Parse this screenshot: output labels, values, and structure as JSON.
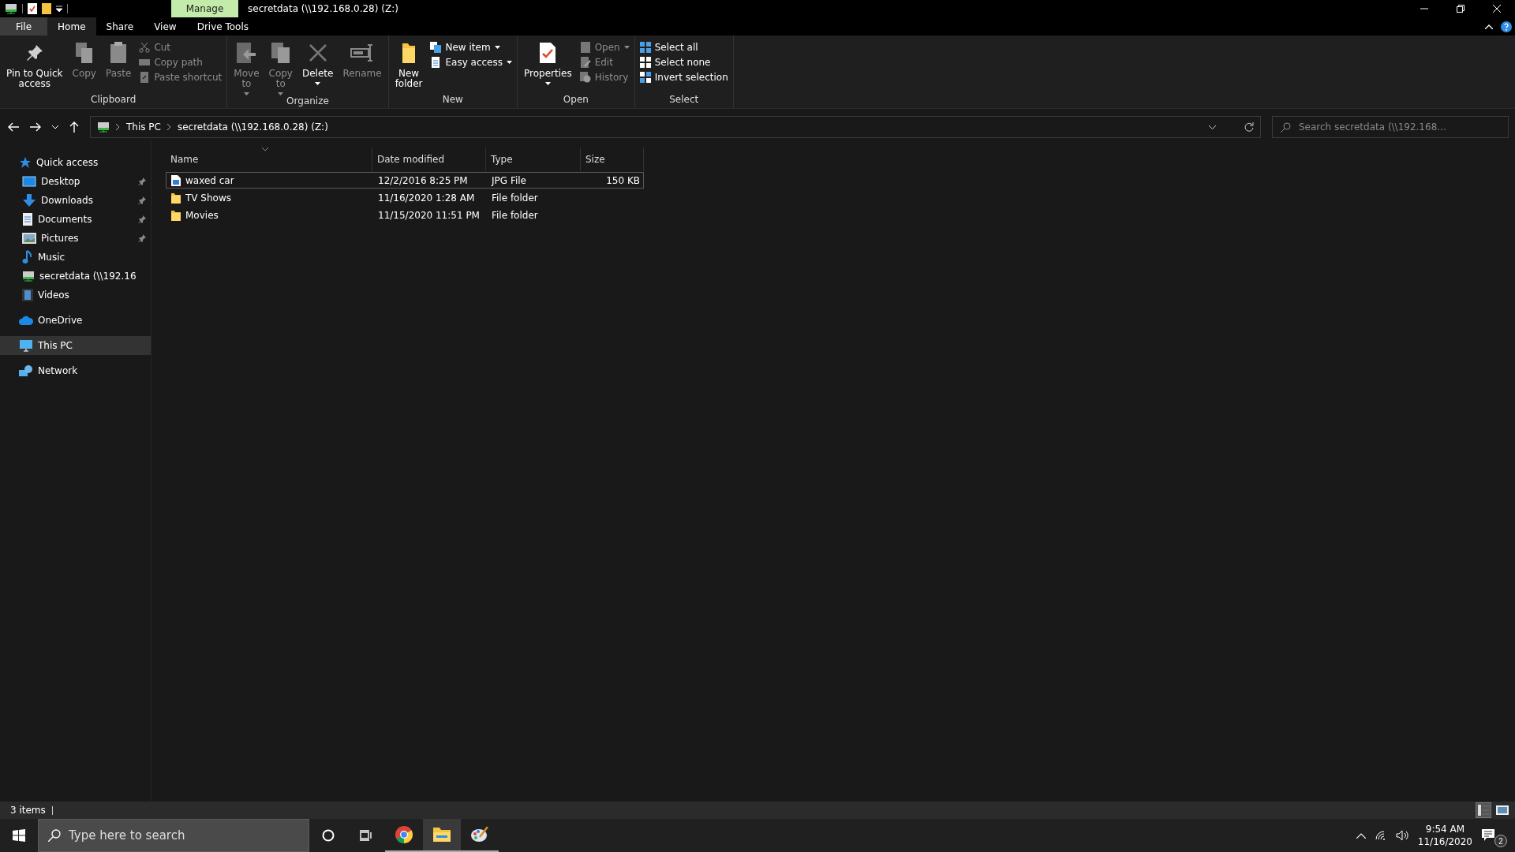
{
  "window": {
    "title": "secretdata (\\\\192.168.0.28) (Z:)",
    "context_tab": "Manage"
  },
  "ribbon_tabs": [
    {
      "label": "File",
      "selected": false,
      "kind": "file"
    },
    {
      "label": "Home",
      "selected": true,
      "kind": "tab"
    },
    {
      "label": "Share",
      "selected": false,
      "kind": "tab"
    },
    {
      "label": "View",
      "selected": false,
      "kind": "tab"
    },
    {
      "label": "Drive Tools",
      "selected": false,
      "kind": "tab"
    }
  ],
  "ribbon_groups": [
    {
      "label": "Clipboard",
      "items": [
        {
          "kind": "large",
          "label": "Pin to Quick\naccess",
          "disabled": false,
          "caret": false
        },
        {
          "kind": "large",
          "label": "Copy",
          "disabled": true,
          "caret": false
        },
        {
          "kind": "large",
          "label": "Paste",
          "disabled": true,
          "caret": false
        },
        {
          "kind": "stack",
          "items": [
            {
              "label": "Cut",
              "disabled": true,
              "caret": false
            },
            {
              "label": "Copy path",
              "disabled": true,
              "caret": false
            },
            {
              "label": "Paste shortcut",
              "disabled": true,
              "caret": false
            }
          ]
        }
      ]
    },
    {
      "label": "Organize",
      "items": [
        {
          "kind": "large",
          "label": "Move\nto",
          "disabled": true,
          "caret": true
        },
        {
          "kind": "large",
          "label": "Copy\nto",
          "disabled": true,
          "caret": true
        },
        {
          "kind": "large",
          "label": "Delete",
          "disabled": false,
          "caret": true
        },
        {
          "kind": "large",
          "label": "Rename",
          "disabled": true,
          "caret": false
        }
      ]
    },
    {
      "label": "New",
      "items": [
        {
          "kind": "large",
          "label": "New\nfolder",
          "disabled": false,
          "caret": false
        },
        {
          "kind": "stack",
          "items": [
            {
              "label": "New item",
              "disabled": false,
              "caret": true
            },
            {
              "label": "Easy access",
              "disabled": false,
              "caret": true
            }
          ]
        }
      ]
    },
    {
      "label": "Open",
      "items": [
        {
          "kind": "large",
          "label": "Properties",
          "disabled": false,
          "caret": true
        },
        {
          "kind": "stack",
          "items": [
            {
              "label": "Open",
              "disabled": true,
              "caret": true
            },
            {
              "label": "Edit",
              "disabled": true,
              "caret": false
            },
            {
              "label": "History",
              "disabled": true,
              "caret": false
            }
          ]
        }
      ]
    },
    {
      "label": "Select",
      "items": [
        {
          "kind": "stack",
          "items": [
            {
              "label": "Select all",
              "disabled": false,
              "caret": false
            },
            {
              "label": "Select none",
              "disabled": false,
              "caret": false
            },
            {
              "label": "Invert selection",
              "disabled": false,
              "caret": false
            }
          ]
        }
      ]
    }
  ],
  "address": {
    "breadcrumbs": [
      "This PC",
      "secretdata (\\\\192.168.0.28) (Z:)"
    ],
    "search_placeholder": "Search secretdata (\\\\192.168..."
  },
  "sidebar": {
    "items": [
      {
        "label": "Quick access",
        "selected": false,
        "children": [
          {
            "label": "Desktop",
            "pinned": true,
            "selected": false
          },
          {
            "label": "Downloads",
            "pinned": true,
            "selected": false
          },
          {
            "label": "Documents",
            "pinned": true,
            "selected": false
          },
          {
            "label": "Pictures",
            "pinned": true,
            "selected": false
          },
          {
            "label": "Music",
            "pinned": false,
            "selected": false
          },
          {
            "label": "secretdata (\\\\192.16",
            "pinned": false,
            "selected": false
          },
          {
            "label": "Videos",
            "pinned": false,
            "selected": false
          }
        ]
      },
      {
        "label": "OneDrive",
        "selected": false
      },
      {
        "label": "This PC",
        "selected": true
      },
      {
        "label": "Network",
        "selected": false
      }
    ]
  },
  "table": {
    "columns": [
      "Name",
      "Date modified",
      "Type",
      "Size"
    ],
    "rows": [
      {
        "kind": "image",
        "name": "waxed car",
        "date": "12/2/2016 8:25 PM",
        "type": "JPG File",
        "size": "150 KB",
        "focused": true
      },
      {
        "kind": "folder",
        "name": "TV Shows",
        "date": "11/16/2020 1:28 AM",
        "type": "File folder",
        "focused": false
      },
      {
        "kind": "folder",
        "name": "Movies",
        "date": "11/15/2020 11:51 PM",
        "type": "File folder",
        "focused": false
      }
    ]
  },
  "status_bar": {
    "count": "3 items",
    "views": [
      {
        "kind": "details",
        "selected": true
      },
      {
        "kind": "large_icons",
        "selected": false
      }
    ]
  },
  "taskbar": {
    "search_placeholder": "Type here to search",
    "apps": [
      {
        "kind": "browser",
        "running": true,
        "selected": false
      },
      {
        "kind": "explorer",
        "running": true,
        "selected": true
      },
      {
        "kind": "paint",
        "running": true,
        "selected": false
      }
    ],
    "time": "9:54 AM",
    "date": "11/16/2020",
    "notifications": "2"
  }
}
